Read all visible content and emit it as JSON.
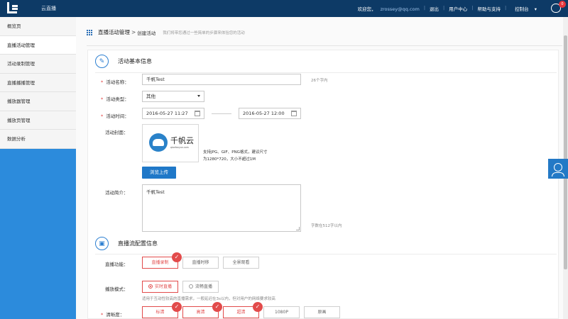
{
  "header": {
    "app_title": "云直播",
    "welcome": "欢迎您，",
    "user_email": "zrossey@qq.com",
    "links": [
      "退出",
      "用户中心",
      "帮助与支持",
      "控制台"
    ],
    "notification_count": "0"
  },
  "sidebar": {
    "items": [
      {
        "label": "概览页",
        "active": false
      },
      {
        "label": "直播活动管理",
        "active": true
      },
      {
        "label": "活动录制管理",
        "active": false
      },
      {
        "label": "直播播播管理",
        "active": false
      },
      {
        "label": "播放器管理",
        "active": false
      },
      {
        "label": "播放页管理",
        "active": false
      },
      {
        "label": "数据分析",
        "active": false
      }
    ]
  },
  "breadcrumb": {
    "main": "直播活动管理",
    "separator": ">",
    "current": "创建活动",
    "hint": "我们将带您通过一些简单的步骤来体验您的活动"
  },
  "basic_info": {
    "title": "活动基本信息",
    "name_label": "活动名称：",
    "name_value": "千帆Test",
    "name_hint": "26个字内",
    "type_label": "活动类型：",
    "type_value": "其他",
    "time_label": "活动时间：",
    "start_time": "2016-05-27 11:27",
    "end_time": "2016-05-27 12:00",
    "cover_label": "活动封面：",
    "cover_brand": "千帆云",
    "cover_url": "qianfanyun.com",
    "cover_hint_1": "支持JPG、GIF、PNG格式，建议尺寸",
    "cover_hint_2": "为1280*720，大小不超过1M",
    "upload_button": "浏览上传",
    "intro_label": "活动简介：",
    "intro_value": "千帆Test",
    "intro_hint": "字数在512字以内"
  },
  "stream_config": {
    "title": "直播流配置信息",
    "function_label": "直播功能：",
    "functions": [
      {
        "label": "直播录制",
        "selected": true
      },
      {
        "label": "直播时移",
        "selected": false
      },
      {
        "label": "全景观看",
        "selected": false
      }
    ],
    "mode_label": "播放模式：",
    "modes": [
      {
        "label": "实时直播",
        "selected": true
      },
      {
        "label": "流畅直播",
        "selected": false
      }
    ],
    "mode_hint": "适用于互动性较高的直播需求，一般延迟在3s以内，但对用户的网络要求较高",
    "quality_label": "清晰度：",
    "qualities": [
      {
        "label": "标清",
        "selected": true
      },
      {
        "label": "高清",
        "selected": true
      },
      {
        "label": "超清",
        "selected": true
      },
      {
        "label": "1080P",
        "selected": false
      },
      {
        "label": "原画",
        "selected": false
      }
    ]
  },
  "icons": {
    "check": "✓"
  },
  "colors": {
    "topbar": "#0d3a66",
    "sidebar_accent": "#2c8bdc",
    "primary": "#1f78c8",
    "selected_red": "#e24b4b"
  }
}
